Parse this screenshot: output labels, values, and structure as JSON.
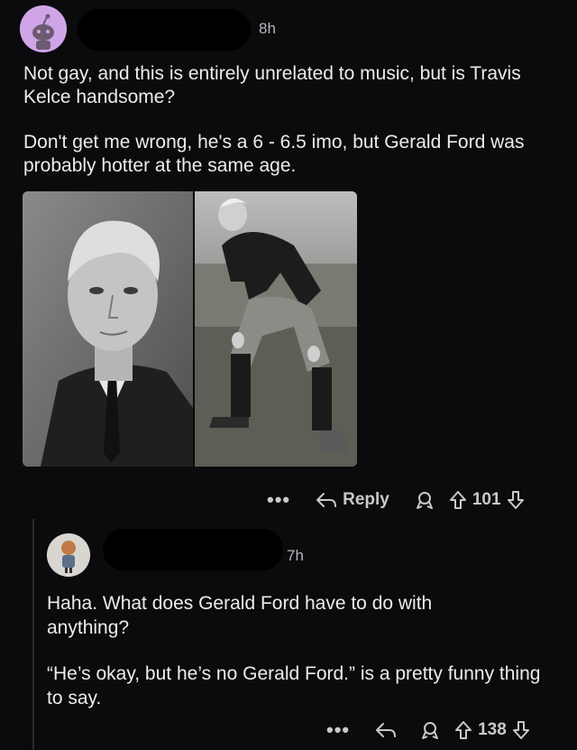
{
  "post": {
    "time": "8h",
    "paragraph1": "Not gay, and this is entirely unrelated to music, but is Travis Kelce handsome?",
    "paragraph2": "Don't get me wrong, he's a 6 - 6.5 imo, but Gerald Ford was probably hotter at the same age.",
    "actions": {
      "more": "•••",
      "reply": "Reply",
      "score": "101"
    }
  },
  "reply": {
    "time": "7h",
    "paragraph1": "Haha. What does Gerald Ford have to do with anything?",
    "paragraph2": "“He’s okay, but he’s no Gerald Ford.” is a pretty funny thing to say.",
    "actions": {
      "more": "•••",
      "score": "138"
    }
  },
  "icons": {
    "avatar": "reddit-snoo-avatar",
    "reply": "reply-arrow-icon",
    "award": "award-icon",
    "upvote": "upvote-arrow-icon",
    "downvote": "downvote-arrow-icon"
  },
  "colors": {
    "background": "#0b0b0d",
    "text": "#ececee",
    "muted": "#c9c9cc",
    "avatar": "#cfa5e8"
  }
}
